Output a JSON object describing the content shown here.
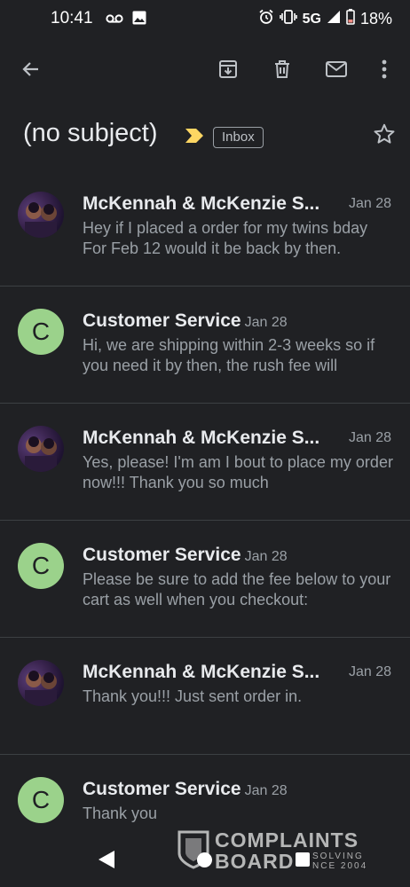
{
  "status_bar": {
    "time": "10:41",
    "left_icons": [
      "voicemail-icon",
      "image-icon"
    ],
    "right_icons": [
      "alarm-icon",
      "vibrate-icon"
    ],
    "network": "5G",
    "battery_percent": "18%",
    "battery_color": "#f28b82"
  },
  "toolbar": {
    "icons": [
      "back-arrow-icon",
      "archive-icon",
      "delete-icon",
      "mark-unread-icon",
      "more-vert-icon"
    ]
  },
  "subject": {
    "title": "(no subject)",
    "label": "Inbox",
    "important_color": "#fdd663"
  },
  "messages": [
    {
      "sender": "McKennah & McKenzie S...",
      "date": "Jan 28",
      "avatar": "photo",
      "snippet": "Hey if I placed a order for my twins bday For Feb 12 would it be back by then."
    },
    {
      "sender": "Customer Service",
      "date": "Jan 28",
      "avatar": "letter",
      "avatar_letter": "C",
      "snippet": "Hi, we are shipping within 2-3 weeks so if you need it by then, the rush fee will"
    },
    {
      "sender": "McKennah & McKenzie S...",
      "date": "Jan 28",
      "avatar": "photo",
      "snippet": "Yes, please! I'm am I bout to place my order now!!! Thank you so much"
    },
    {
      "sender": "Customer Service",
      "date": "Jan 28",
      "avatar": "letter",
      "avatar_letter": "C",
      "snippet": "Please be sure to add the fee below to your cart as well when you checkout:"
    },
    {
      "sender": "McKennah & McKenzie S...",
      "date": "Jan 28",
      "avatar": "photo",
      "snippet": "Thank you!!! Just sent order in."
    },
    {
      "sender": "Customer Service",
      "date": "Jan 28",
      "avatar": "letter",
      "avatar_letter": "C",
      "snippet": "Thank you"
    }
  ],
  "colors": {
    "background": "#202124",
    "avatar_green": "#9bd28b",
    "divider": "#3c4043",
    "secondary_text": "#9aa0a6"
  },
  "watermark": {
    "line1": "COMPLAINTS",
    "line2": "BOARD",
    "sub1": "SOLVING",
    "sub2": "NCE 2004"
  },
  "nav_bar": {
    "icons": [
      "nav-back-icon",
      "nav-home-icon",
      "nav-recents-icon"
    ]
  }
}
